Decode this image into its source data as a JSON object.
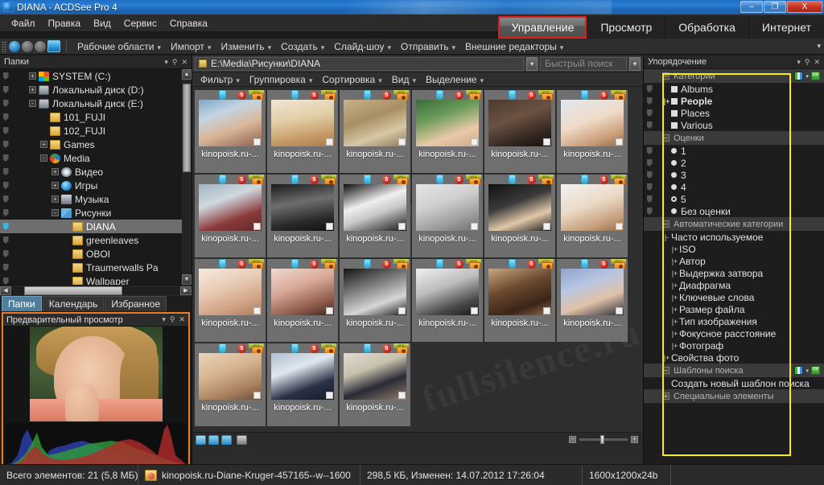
{
  "window": {
    "title": "DIANA - ACDSee Pro 4",
    "minimize_label": "–",
    "maximize_label": "❐",
    "close_label": "X"
  },
  "menubar": {
    "items": [
      "Файл",
      "Правка",
      "Вид",
      "Сервис",
      "Справка"
    ]
  },
  "mode_tabs": [
    {
      "label": "Управление",
      "active": true,
      "highlighted": true
    },
    {
      "label": "Просмотр",
      "active": false,
      "highlighted": false
    },
    {
      "label": "Обработка",
      "active": false,
      "highlighted": false
    },
    {
      "label": "Интернет",
      "active": false,
      "highlighted": false
    }
  ],
  "toolbar": {
    "items": [
      "Рабочие области",
      "Импорт",
      "Изменить",
      "Создать",
      "Слайд-шоу",
      "Отправить",
      "Внешние редакторы"
    ],
    "overflow_label": "▾"
  },
  "left_panel": {
    "header_title": "Папки",
    "header_buttons": [
      "▾",
      "⚑",
      "✕"
    ],
    "tree": [
      {
        "label": "SYSTEM (C:)",
        "indent": 1,
        "expander": "+",
        "icon": "windows-drive-icon",
        "selected": false
      },
      {
        "label": "Локальный диск (D:)",
        "indent": 1,
        "expander": "+",
        "icon": "drive-icon",
        "selected": false
      },
      {
        "label": "Локальный диск (E:)",
        "indent": 1,
        "expander": "-",
        "icon": "drive-icon",
        "selected": false
      },
      {
        "label": "101_FUJI",
        "indent": 2,
        "expander": "",
        "icon": "folder-icon",
        "selected": false
      },
      {
        "label": "102_FUJI",
        "indent": 2,
        "expander": "",
        "icon": "folder-icon",
        "selected": false
      },
      {
        "label": "Games",
        "indent": 2,
        "expander": "+",
        "icon": "folder-icon",
        "selected": false
      },
      {
        "label": "Media",
        "indent": 2,
        "expander": "-",
        "icon": "media-folder-icon",
        "selected": false
      },
      {
        "label": "Видео",
        "indent": 3,
        "expander": "+",
        "icon": "video-folder-icon",
        "selected": false
      },
      {
        "label": "Игры",
        "indent": 3,
        "expander": "+",
        "icon": "games-folder-icon",
        "selected": false
      },
      {
        "label": "Музыка",
        "indent": 3,
        "expander": "+",
        "icon": "music-folder-icon",
        "selected": false
      },
      {
        "label": "Рисунки",
        "indent": 3,
        "expander": "-",
        "icon": "pictures-folder-icon",
        "selected": false
      },
      {
        "label": "DIANA",
        "indent": 4,
        "expander": "",
        "icon": "folder-icon",
        "selected": true
      },
      {
        "label": "greenleaves",
        "indent": 4,
        "expander": "",
        "icon": "folder-icon",
        "selected": false
      },
      {
        "label": "OBOI",
        "indent": 4,
        "expander": "",
        "icon": "folder-icon",
        "selected": false
      },
      {
        "label": "Traumerwalls Pa",
        "indent": 4,
        "expander": "",
        "icon": "folder-icon",
        "selected": false
      },
      {
        "label": "Wallpaper",
        "indent": 4,
        "expander": "",
        "icon": "folder-icon",
        "selected": false
      }
    ],
    "tabs": [
      {
        "label": "Папки",
        "active": true
      },
      {
        "label": "Календарь",
        "active": false
      },
      {
        "label": "Избранное",
        "active": false
      }
    ],
    "preview": {
      "title": "Предварительный просмотр",
      "buttons": [
        "▾",
        "⚑",
        "✕"
      ]
    }
  },
  "center": {
    "path": "E:\\Media\\Рисунки\\DIANA",
    "path_dropdown_label": "▾",
    "search_placeholder": "Быстрый поиск",
    "search_dropdown_label": "▾",
    "filterbar": [
      "Фильтр",
      "Группировка",
      "Сортировка",
      "Вид",
      "Выделение"
    ],
    "thumbnail_caption": "kinopoisk.ru-...",
    "thumbnail_rating": "5",
    "thumbnail_format_tag": "JPG",
    "thumbnails_count": 21,
    "zoom_minus": "−",
    "zoom_plus": "+"
  },
  "right_panel": {
    "header_title": "Упорядочение",
    "header_buttons": [
      "▾",
      "⚑",
      "✕"
    ],
    "sections": [
      {
        "title": "Категории",
        "collapse": "–",
        "has_icons": true,
        "items": [
          {
            "label": "Albums",
            "marker": "square",
            "expander": "",
            "indent": 0,
            "bold": false
          },
          {
            "label": "People",
            "marker": "square",
            "expander": "+",
            "indent": 0,
            "bold": true
          },
          {
            "label": "Places",
            "marker": "square",
            "expander": "",
            "indent": 0,
            "bold": false
          },
          {
            "label": "Various",
            "marker": "square",
            "expander": "",
            "indent": 0,
            "bold": false
          }
        ]
      },
      {
        "title": "Оценки",
        "collapse": "–",
        "has_icons": false,
        "items": [
          {
            "label": "1",
            "marker": "dot",
            "expander": "",
            "indent": 0,
            "bold": false
          },
          {
            "label": "2",
            "marker": "dot",
            "expander": "",
            "indent": 0,
            "bold": false
          },
          {
            "label": "3",
            "marker": "dot",
            "expander": "",
            "indent": 0,
            "bold": false
          },
          {
            "label": "4",
            "marker": "dot",
            "expander": "",
            "indent": 0,
            "bold": false
          },
          {
            "label": "5",
            "marker": "dot-hollow",
            "expander": "",
            "indent": 0,
            "bold": false
          },
          {
            "label": "Без оценки",
            "marker": "dot",
            "expander": "",
            "indent": 0,
            "bold": false
          }
        ]
      },
      {
        "title": "Автоматические категории",
        "collapse": "–",
        "has_icons": false,
        "items": [
          {
            "label": "Часто используемое",
            "marker": "none",
            "expander": "-",
            "indent": 0,
            "bold": false
          },
          {
            "label": "ISO",
            "marker": "none",
            "expander": "+",
            "indent": 1,
            "bold": false
          },
          {
            "label": "Автор",
            "marker": "none",
            "expander": "+",
            "indent": 1,
            "bold": false
          },
          {
            "label": "Выдержка затвора",
            "marker": "none",
            "expander": "+",
            "indent": 1,
            "bold": false
          },
          {
            "label": "Диафрагма",
            "marker": "none",
            "expander": "+",
            "indent": 1,
            "bold": false
          },
          {
            "label": "Ключевые слова",
            "marker": "none",
            "expander": "+",
            "indent": 1,
            "bold": false
          },
          {
            "label": "Размер файла",
            "marker": "none",
            "expander": "+",
            "indent": 1,
            "bold": false
          },
          {
            "label": "Тип изображения",
            "marker": "none",
            "expander": "+",
            "indent": 1,
            "bold": false
          },
          {
            "label": "Фокусное расстояние",
            "marker": "none",
            "expander": "+",
            "indent": 1,
            "bold": false
          },
          {
            "label": "Фотограф",
            "marker": "none",
            "expander": "+",
            "indent": 1,
            "bold": false
          },
          {
            "label": "Свойства фото",
            "marker": "none",
            "expander": "+",
            "indent": 0,
            "bold": false
          }
        ]
      },
      {
        "title": "Шаблоны поиска",
        "collapse": "–",
        "has_icons": true,
        "items": [
          {
            "label": "Создать новый шаблон поиска",
            "marker": "none",
            "expander": "",
            "indent": 0,
            "bold": false
          }
        ]
      },
      {
        "title": "Специальные элементы",
        "collapse": "+",
        "has_icons": false,
        "items": []
      }
    ]
  },
  "statusbar": {
    "total": "Всего элементов: 21  (5,8 МБ)",
    "filename": "kinopoisk.ru-Diane-Kruger-457165--w--1600",
    "fileinfo": "298,5 КБ, Изменен: 14.07.2012 17:26:04",
    "dimensions": "1600x1200x24b"
  },
  "colors": {
    "accent_red": "#e21b1b",
    "accent_yellow": "#ffec00",
    "accent_orange": "#f07a1e",
    "selection_blue": "#4f7f9c",
    "title_blue": "#2a7fd4"
  },
  "watermark": "fullsilence.ru",
  "thumbnails": [
    {
      "id": 1,
      "bg": "linear-gradient(160deg,#7fa6c6 0%,#c4d5e2 30%,#d9b79a 60%,#8f5f4a 100%)"
    },
    {
      "id": 2,
      "bg": "linear-gradient(170deg,#efe6d6 0%,#e3cfa8 40%,#c79c68 75%,#a87c52 100%)"
    },
    {
      "id": 3,
      "bg": "linear-gradient(160deg,#c9b28a 0%,#a88f62 40%,#d6c7a6 70%,#8d7a55 100%)"
    },
    {
      "id": 4,
      "bg": "linear-gradient(160deg,#3a6b3a 0%,#6b9b5a 35%,#e8c9a8 70%,#cfa98a 100%)"
    },
    {
      "id": 5,
      "bg": "linear-gradient(160deg,#4a3a30 0%,#6b5242 40%,#2b211c 80%,#1a1412 100%)"
    },
    {
      "id": 6,
      "bg": "linear-gradient(160deg,#dfe7ee 0%,#f0dcc9 45%,#c79a74 80%,#8d6a4e 100%)"
    },
    {
      "id": 7,
      "bg": "linear-gradient(160deg,#9fb4c4 0%,#cfd8de 35%,#8c3a3a 70%,#5a2a2a 100%)"
    },
    {
      "id": 8,
      "bg": "linear-gradient(170deg,#1a1a1a 0%,#6e6e6e 40%,#2a2a2a 75%,#0f0f0f 100%)"
    },
    {
      "id": 9,
      "bg": "linear-gradient(160deg,#0d0d0d 0%,#efefef 40%,#c9c9c9 60%,#161616 100%)"
    },
    {
      "id": 10,
      "bg": "linear-gradient(160deg,#e6e6e6 0%,#cfcfcf 40%,#9a9a9a 75%,#6e6e6e 100%)"
    },
    {
      "id": 11,
      "bg": "linear-gradient(160deg,#111111 0%,#3a3a3a 40%,#e2c8a8 70%,#1a1a1a 100%)"
    },
    {
      "id": 12,
      "bg": "linear-gradient(160deg,#f3f3f3 0%,#ead9c6 45%,#c49a78 80%,#8f6a4e 100%)"
    },
    {
      "id": 13,
      "bg": "linear-gradient(160deg,#f6eae0 0%,#e8cbb4 40%,#cf9f80 75%,#a87a5e 100%)"
    },
    {
      "id": 14,
      "bg": "linear-gradient(160deg,#efd9d2 0%,#d9a898 40%,#8f5b4a 75%,#3a2420 100%)"
    },
    {
      "id": 15,
      "bg": "linear-gradient(160deg,#141414 0%,#8f8f8f 45%,#d6d6d6 70%,#1c1c1c 100%)"
    },
    {
      "id": 16,
      "bg": "linear-gradient(160deg,#f0f0f0 0%,#bdbdbd 40%,#4a4a4a 75%,#1a1a1a 100%)"
    },
    {
      "id": 17,
      "bg": "linear-gradient(160deg,#c9a882 0%,#6b4a30 40%,#3a2418 75%,#8f6a4e 100%)"
    },
    {
      "id": 18,
      "bg": "linear-gradient(160deg,#8fa3cf 0%,#b9c6e2 35%,#e0c2a8 65%,#2a2a3a 100%)"
    },
    {
      "id": 19,
      "bg": "linear-gradient(160deg,#e8d4b8 0%,#d6b48f 40%,#a87f5e 75%,#6b4e38 100%)"
    },
    {
      "id": 20,
      "bg": "linear-gradient(160deg,#aebfcf 0%,#dfe7ee 35%,#2a3246 70%,#151a28 100%)"
    },
    {
      "id": 21,
      "bg": "linear-gradient(160deg,#dfdccf 0%,#c7c0ad 35%,#2a2a36 65%,#8f7f6a 100%)"
    }
  ]
}
